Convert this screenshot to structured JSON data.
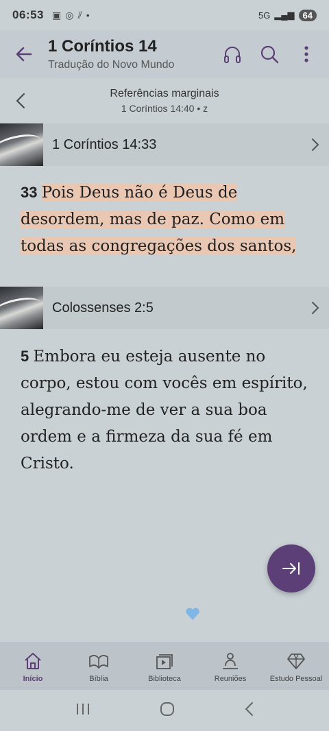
{
  "status": {
    "time": "06:53",
    "battery": "64",
    "network": "5G"
  },
  "app_bar": {
    "title": "1 Coríntios 14",
    "subtitle": "Tradução do Novo Mundo"
  },
  "references": {
    "title": "Referências marginais",
    "subtitle": "1 Coríntios 14:40 • z"
  },
  "entries": [
    {
      "reference": "1 Coríntios 14:33",
      "verse_number": "33",
      "verse_text": "Pois Deus não é Deus de desordem, mas de paz. Como em todas as congregações dos santos,"
    },
    {
      "reference": "Colossenses 2:5",
      "verse_number": "5",
      "verse_text": "Embora eu esteja ausente no corpo, estou com vocês em espírito, alegrando-me de ver a sua boa ordem e a firmeza da sua fé em Cristo."
    }
  ],
  "bottom_nav": [
    {
      "label": "Início",
      "icon": "home-icon",
      "active": true
    },
    {
      "label": "Bíblia",
      "icon": "bible-icon",
      "active": false
    },
    {
      "label": "Biblioteca",
      "icon": "library-icon",
      "active": false
    },
    {
      "label": "Reuniões",
      "icon": "meetings-icon",
      "active": false
    },
    {
      "label": "Estudo Pessoal",
      "icon": "diamond-icon",
      "active": false
    }
  ],
  "colors": {
    "accent": "#5d3f78",
    "highlight": "#e9c7b3",
    "background": "#c9d1d5"
  }
}
